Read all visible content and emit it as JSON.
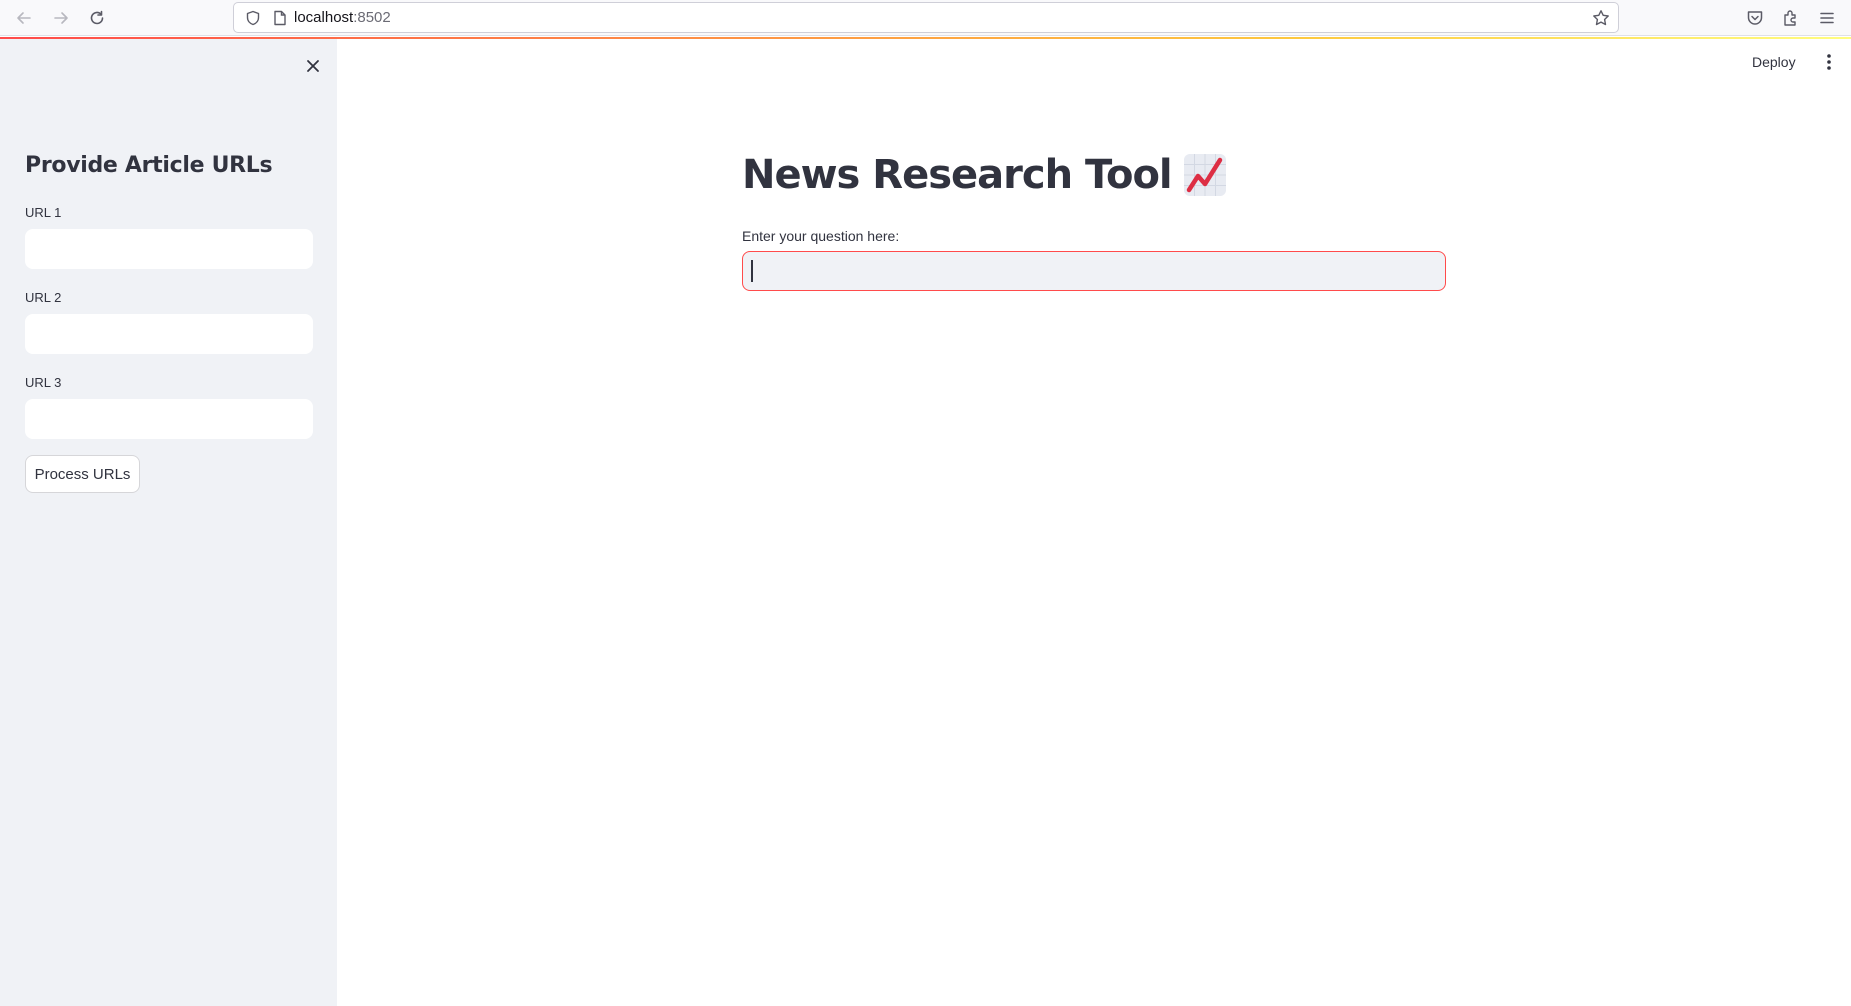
{
  "browser": {
    "url_host": "localhost",
    "url_port": ":8502"
  },
  "sidebar": {
    "header": "Provide Article URLs",
    "fields": [
      {
        "label": "URL 1",
        "value": ""
      },
      {
        "label": "URL 2",
        "value": ""
      },
      {
        "label": "URL 3",
        "value": ""
      }
    ],
    "button_label": "Process URLs"
  },
  "header": {
    "deploy_label": "Deploy"
  },
  "main": {
    "title": "News Research Tool",
    "title_emoji_icon": "chart-increasing-icon",
    "question_label": "Enter your question here:",
    "question_value": ""
  },
  "colors": {
    "accent": "#ff4b4b",
    "sidebar_bg": "#f0f2f6",
    "text": "#31333f"
  }
}
